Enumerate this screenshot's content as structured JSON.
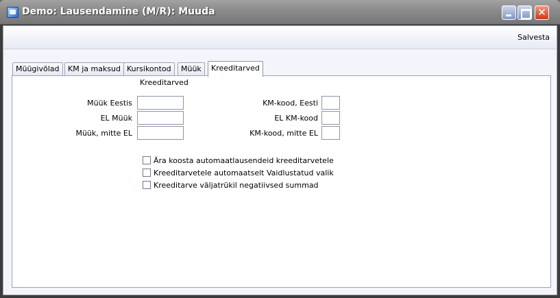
{
  "window": {
    "title": "Demo: Lausendamine (M/R): Muuda",
    "minimize_icon": "minimize-icon",
    "maximize_icon": "maximize-icon",
    "close_icon": "close-icon",
    "close_glyph": "✕"
  },
  "toolbar": {
    "save_label": "Salvesta"
  },
  "tabs": [
    {
      "label": "Müügivõlad"
    },
    {
      "label": "KM ja maksud"
    },
    {
      "label": "Kursikontod"
    },
    {
      "label": "Müük"
    },
    {
      "label": "Kreeditarved"
    }
  ],
  "active_tab": "Kreeditarved",
  "panel": {
    "section_title": "Kreeditarved",
    "left_fields": [
      {
        "label": "Müük Eestis",
        "value": ""
      },
      {
        "label": "EL Müük",
        "value": ""
      },
      {
        "label": "Müük, mitte EL",
        "value": ""
      }
    ],
    "right_fields": [
      {
        "label": "KM-kood, Eesti",
        "value": ""
      },
      {
        "label": "EL KM-kood",
        "value": ""
      },
      {
        "label": "KM-kood, mitte EL",
        "value": ""
      }
    ],
    "checkboxes": [
      {
        "label": "Ära koosta automaatlausendeid kreeditarvetele",
        "checked": false
      },
      {
        "label": "Kreeditarvetele automaatselt Vaidlustatud valik",
        "checked": false
      },
      {
        "label": "Kreeditarve väljatrükil negatiivsed summad",
        "checked": false
      }
    ]
  }
}
